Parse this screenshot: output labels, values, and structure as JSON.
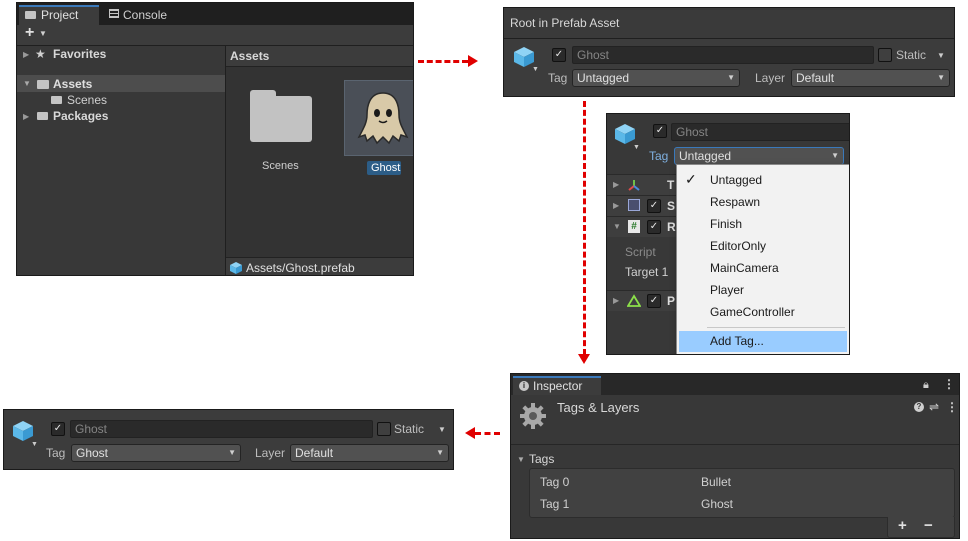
{
  "project": {
    "tabs": [
      {
        "label": "Project"
      },
      {
        "label": "Console"
      }
    ],
    "add_label": "+",
    "tree": {
      "favorites": "Favorites",
      "assets": "Assets",
      "scenes": "Scenes",
      "packages": "Packages"
    },
    "assets_header": "Assets",
    "items": [
      {
        "label": "Scenes"
      },
      {
        "label": "Ghost"
      }
    ],
    "path": "Assets/Ghost.prefab"
  },
  "prefab_header": {
    "title": "Root in Prefab Asset",
    "name": "Ghost",
    "static_label": "Static",
    "tag_label": "Tag",
    "tag_value": "Untagged",
    "layer_label": "Layer",
    "layer_value": "Default"
  },
  "tag_dropdown": {
    "name": "Ghost",
    "tag_label": "Tag",
    "tag_value": "Untagged",
    "components": [
      {
        "label": "T"
      },
      {
        "label": "S"
      },
      {
        "label": "R"
      },
      {
        "label": "P"
      }
    ],
    "script_label": "Script",
    "target_label": "Target 1",
    "options": [
      {
        "label": "Untagged",
        "checked": true
      },
      {
        "label": "Respawn",
        "checked": false
      },
      {
        "label": "Finish",
        "checked": false
      },
      {
        "label": "EditorOnly",
        "checked": false
      },
      {
        "label": "MainCamera",
        "checked": false
      },
      {
        "label": "Player",
        "checked": false
      },
      {
        "label": "GameController",
        "checked": false
      }
    ],
    "add_tag": "Add Tag..."
  },
  "inspector": {
    "tab": "Inspector",
    "title": "Tags & Layers",
    "section": "Tags",
    "tags": [
      {
        "key": "Tag 0",
        "value": "Bullet"
      },
      {
        "key": "Tag 1",
        "value": "Ghost"
      }
    ],
    "plus": "+",
    "minus": "−"
  },
  "result_header": {
    "name": "Ghost",
    "static_label": "Static",
    "tag_label": "Tag",
    "tag_value": "Ghost",
    "layer_label": "Layer",
    "layer_value": "Default"
  },
  "colors": {
    "arrow": "#e00000",
    "selection": "#99ccff",
    "panel": "#383838",
    "accent_cube": "#5bb8e8"
  }
}
